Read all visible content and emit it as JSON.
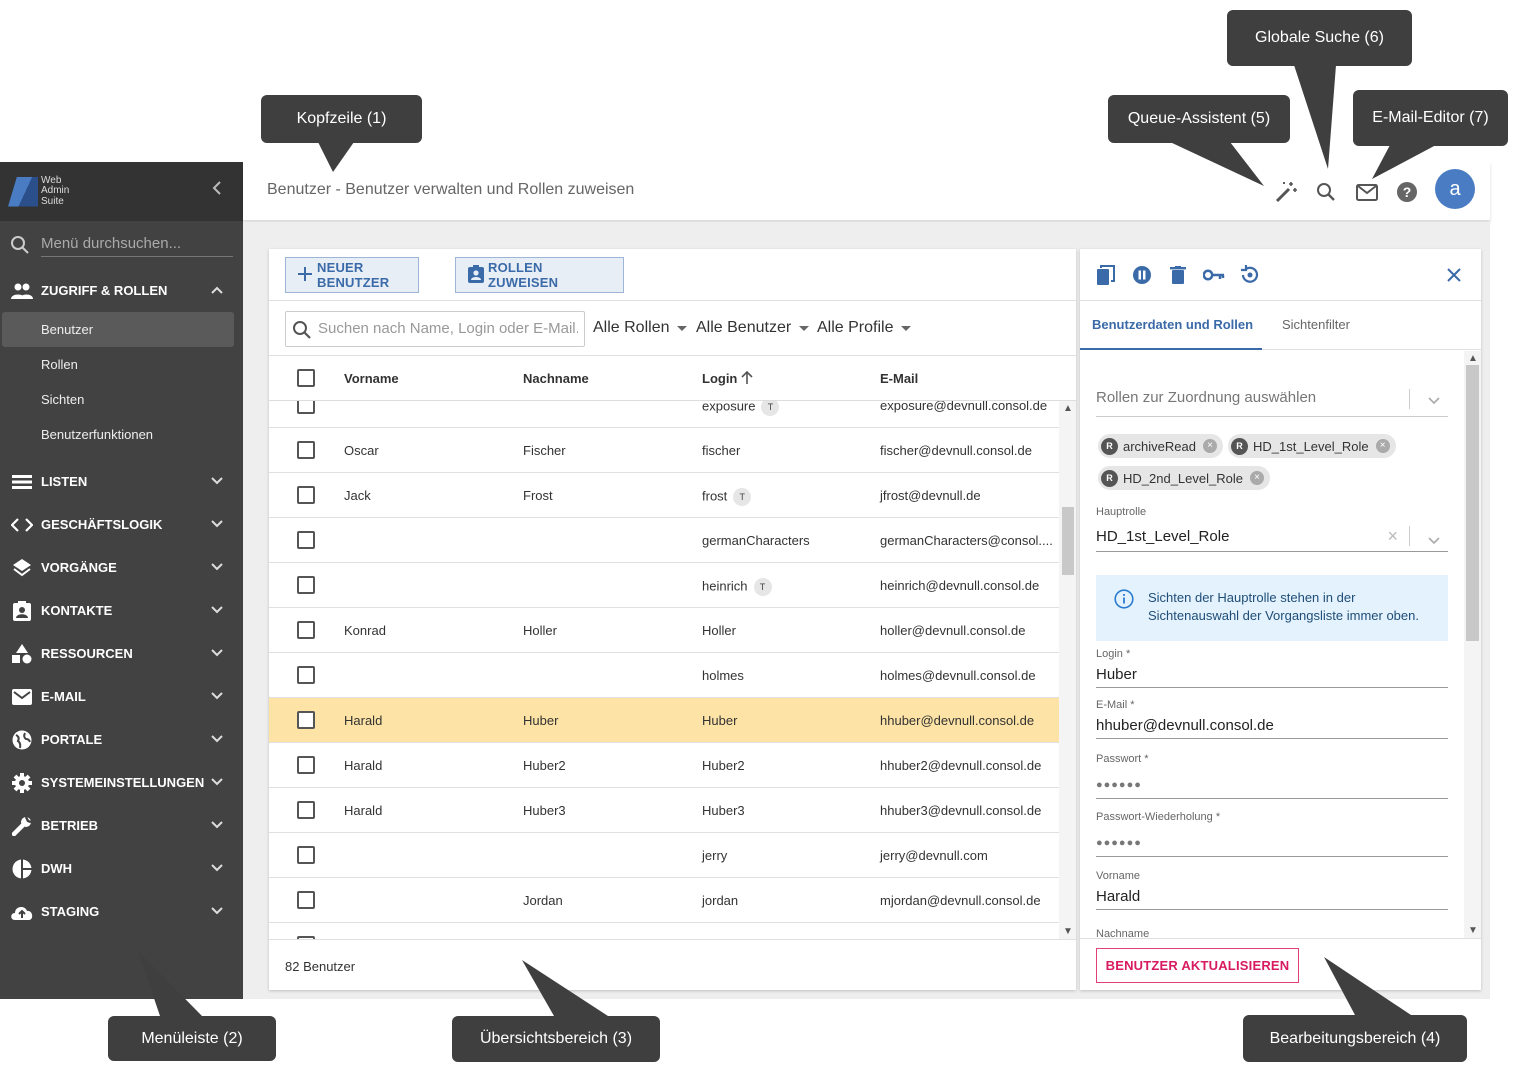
{
  "app": {
    "logo_text": [
      "Web",
      "Admin",
      "Suite"
    ]
  },
  "sidebar": {
    "search_placeholder": "Menü durchsuchen...",
    "groups": [
      {
        "label": "ZUGRIFF & ROLLEN",
        "icon": "people-icon",
        "expanded": true
      },
      {
        "label": "LISTEN",
        "icon": "list-icon"
      },
      {
        "label": "GESCHÄFTSLOGIK",
        "icon": "code-icon"
      },
      {
        "label": "VORGÄNGE",
        "icon": "layers-icon"
      },
      {
        "label": "KONTAKTE",
        "icon": "contact-icon"
      },
      {
        "label": "RESSOURCEN",
        "icon": "shapes-icon"
      },
      {
        "label": "E-MAIL",
        "icon": "mail-icon"
      },
      {
        "label": "PORTALE",
        "icon": "globe-icon"
      },
      {
        "label": "SYSTEMEINSTELLUNGEN",
        "icon": "gear-icon"
      },
      {
        "label": "BETRIEB",
        "icon": "wrench-icon"
      },
      {
        "label": "DWH",
        "icon": "pie-chart-icon"
      },
      {
        "label": "STAGING",
        "icon": "cloud-upload-icon"
      }
    ],
    "sub_items": [
      "Benutzer",
      "Rollen",
      "Sichten",
      "Benutzerfunktionen"
    ]
  },
  "header": {
    "title": "Benutzer - Benutzer verwalten und Rollen zuweisen",
    "avatar": "a"
  },
  "toolbar": {
    "new_user": "NEUER BENUTZER",
    "assign_roles": "ROLLEN ZUWEISEN"
  },
  "filters": {
    "search_placeholder": "Suchen nach Name, Login oder E-Mail...",
    "roles": "Alle Rollen",
    "users": "Alle Benutzer",
    "profiles": "Alle Profile"
  },
  "table": {
    "columns": [
      "Vorname",
      "Nachname",
      "Login",
      "E-Mail"
    ],
    "rows": [
      {
        "first": "",
        "last": "",
        "login": "exposure",
        "badge": "T",
        "email": "exposure@devnull.consol.de"
      },
      {
        "first": "Oscar",
        "last": "Fischer",
        "login": "fischer",
        "badge": "",
        "email": "fischer@devnull.consol.de"
      },
      {
        "first": "Jack",
        "last": "Frost",
        "login": "frost",
        "badge": "T",
        "email": "jfrost@devnull.de"
      },
      {
        "first": "",
        "last": "",
        "login": "germanCharacters",
        "badge": "",
        "email": "germanCharacters@consol...."
      },
      {
        "first": "",
        "last": "",
        "login": "heinrich",
        "badge": "T",
        "email": "heinrich@devnull.consol.de"
      },
      {
        "first": "Konrad",
        "last": "Holler",
        "login": "Holler",
        "badge": "",
        "email": "holler@devnull.consol.de"
      },
      {
        "first": "",
        "last": "",
        "login": "holmes",
        "badge": "",
        "email": "holmes@devnull.consol.de"
      },
      {
        "first": "Harald",
        "last": "Huber",
        "login": "Huber",
        "badge": "",
        "email": "hhuber@devnull.consol.de",
        "selected": true
      },
      {
        "first": "Harald",
        "last": "Huber2",
        "login": "Huber2",
        "badge": "",
        "email": "hhuber2@devnull.consol.de"
      },
      {
        "first": "Harald",
        "last": "Huber3",
        "login": "Huber3",
        "badge": "",
        "email": "hhuber3@devnull.consol.de"
      },
      {
        "first": "",
        "last": "",
        "login": "jerry",
        "badge": "",
        "email": "jerry@devnull.com"
      },
      {
        "first": "",
        "last": "Jordan",
        "login": "jordan",
        "badge": "",
        "email": "mjordan@devnull.consol.de"
      }
    ],
    "count": "82 Benutzer"
  },
  "edit": {
    "tabs": [
      "Benutzerdaten und Rollen",
      "Sichtenfilter"
    ],
    "roles_placeholder": "Rollen zur Zuordnung auswählen",
    "chip_prefix": "R",
    "chips": [
      "archiveRead",
      "HD_1st_Level_Role",
      "HD_2nd_Level_Role"
    ],
    "main_role_label": "Hauptrolle",
    "main_role": "HD_1st_Level_Role",
    "info": "Sichten der Hauptrolle stehen in der Sichtenauswahl der Vorgangsliste immer oben.",
    "fields": [
      {
        "label": "Login *",
        "value": "Huber"
      },
      {
        "label": "E-Mail *",
        "value": "hhuber@devnull.consol.de"
      },
      {
        "label": "Passwort *",
        "value": "●●●●●●"
      },
      {
        "label": "Passwort-Wiederholung *",
        "value": "●●●●●●"
      },
      {
        "label": "Vorname",
        "value": "Harald"
      },
      {
        "label": "Nachname",
        "value": ""
      }
    ],
    "update_button": "BENUTZER AKTUALISIEREN"
  },
  "callouts": {
    "header": "Kopfzeile (1)",
    "menu": "Menüleiste (2)",
    "overview": "Übersichtsbereich (3)",
    "edit": "Bearbeitungsbereich (4)",
    "queue": "Queue-Assistent (5)",
    "search": "Globale Suche (6)",
    "email": "E-Mail-Editor (7)"
  },
  "colors": {
    "accent": "#3a6aa8",
    "selected_row": "#fde3a5",
    "sidebar": "#424242",
    "update_button": "#d81b60",
    "callout": "#3f3f3f"
  }
}
